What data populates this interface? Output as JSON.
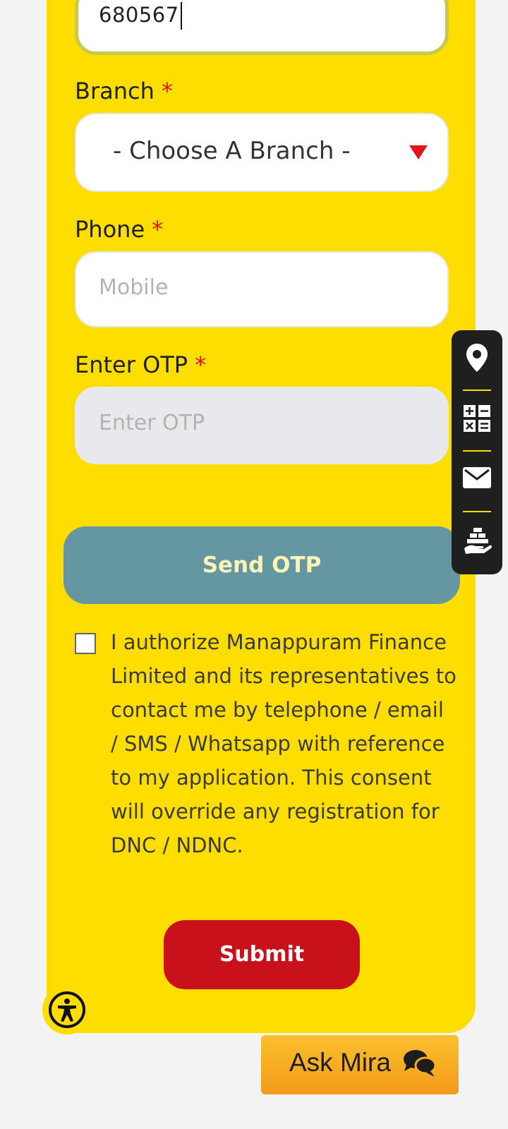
{
  "pincode": {
    "value": "680567"
  },
  "branch": {
    "label": "Branch",
    "required_mark": "*",
    "selected": "- Choose A Branch -"
  },
  "phone": {
    "label": "Phone",
    "required_mark": "*",
    "placeholder": "Mobile"
  },
  "otp": {
    "label": "Enter OTP",
    "required_mark": "*",
    "placeholder": "Enter OTP"
  },
  "send_otp_label": "Send OTP",
  "consent": {
    "checked": false,
    "text": "I authorize Manappuram Finance Limited and its representatives to contact me by telephone / email / SMS / Whatsapp with reference to my application. This consent will override any registration for DNC / NDNC."
  },
  "submit_label": "Submit",
  "side_toolbar": {
    "items": [
      "location-icon",
      "calculator-icon",
      "mail-icon",
      "gold-loan-icon"
    ]
  },
  "ask_mira": {
    "label": "Ask Mira",
    "icon": "chat-icon"
  },
  "accessibility": {
    "icon": "accessibility-icon"
  },
  "colors": {
    "card_background": "#fede00",
    "required": "#e3141b",
    "send_otp": "#6497a2",
    "submit": "#c8111a",
    "ask_mira": "#f7ad24"
  }
}
